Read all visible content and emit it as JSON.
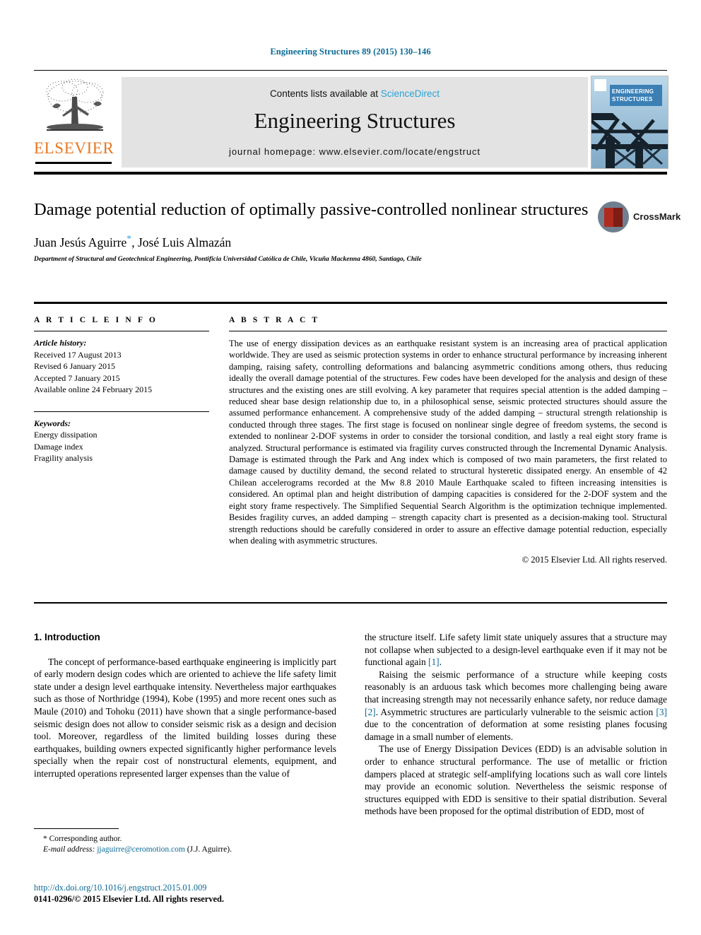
{
  "running_head": "Engineering Structures 89 (2015) 130–146",
  "masthead": {
    "contents_prefix": "Contents lists available at ",
    "sciencedirect": "ScienceDirect",
    "journal_title": "Engineering Structures",
    "homepage": "journal homepage: www.elsevier.com/locate/engstruct",
    "publisher_logo_text": "ELSEVIER",
    "cover_label": "ENGINEERING STRUCTURES",
    "sciencedirect_color": "#2aa3d6",
    "logo_color": "#e87722"
  },
  "article": {
    "title": "Damage potential reduction of optimally passive-controlled nonlinear structures",
    "authors": "Juan Jesús Aguirre",
    "authors_rest": ", José Luis Almazán",
    "corresponding_marker": "*",
    "affiliation": "Department of Structural and Geotechnical Engineering, Pontificia Universidad Católica de Chile, Vicuña Mackenna 4860, Santiago, Chile",
    "crossmark_label": "CrossMark"
  },
  "article_info": {
    "heading": "A R T I C L E  I N F O",
    "history_label": "Article history:",
    "history": [
      "Received 17 August 2013",
      "Revised 6 January 2015",
      "Accepted 7 January 2015",
      "Available online 24 February 2015"
    ],
    "keywords_label": "Keywords:",
    "keywords": [
      "Energy dissipation",
      "Damage index",
      "Fragility analysis"
    ]
  },
  "abstract": {
    "heading": "A B S T R A C T",
    "text": "The use of energy dissipation devices as an earthquake resistant system is an increasing area of practical application worldwide. They are used as seismic protection systems in order to enhance structural performance by increasing inherent damping, raising safety, controlling deformations and balancing asymmetric conditions among others, thus reducing ideally the overall damage potential of the structures. Few codes have been developed for the analysis and design of these structures and the existing ones are still evolving. A key parameter that requires special attention is the added damping – reduced shear base design relationship due to, in a philosophical sense, seismic protected structures should assure the assumed performance enhancement. A comprehensive study of the added damping – structural strength relationship is conducted through three stages. The first stage is focused on nonlinear single degree of freedom systems, the second is extended to nonlinear 2-DOF systems in order to consider the torsional condition, and lastly a real eight story frame is analyzed. Structural performance is estimated via fragility curves constructed through the Incremental Dynamic Analysis. Damage is estimated through the Park and Ang index which is composed of two main parameters, the first related to damage caused by ductility demand, the second related to structural hysteretic dissipated energy. An ensemble of 42 Chilean accelerograms recorded at the Mw 8.8 2010 Maule Earthquake scaled to fifteen increasing intensities is considered. An optimal plan and height distribution of damping capacities is considered for the 2-DOF system and the eight story frame respectively. The Simplified Sequential Search Algorithm is the optimization technique implemented. Besides fragility curves, an added damping – strength capacity chart is presented as a decision-making tool. Structural strength reductions should be carefully considered in order to assure an effective damage potential reduction, especially when dealing with asymmetric structures.",
    "copyright": "© 2015 Elsevier Ltd. All rights reserved."
  },
  "introduction": {
    "heading": "1. Introduction",
    "left_paragraph": "The concept of performance-based earthquake engineering is implicitly part of early modern design codes which are oriented to achieve the life safety limit state under a design level earthquake intensity. Nevertheless major earthquakes such as those of Northridge (1994), Kobe (1995) and more recent ones such as Maule (2010) and Tohoku (2011) have shown that a single performance-based seismic design does not allow to consider seismic risk as a design and decision tool. Moreover, regardless of the limited building losses during these earthquakes, building owners expected significantly higher performance levels specially when the repair cost of nonstructural elements, equipment, and interrupted operations represented larger expenses than the value of",
    "right_paragraph_1a": "the structure itself. Life safety limit state uniquely assures that a structure may not collapse when subjected to a design-level earthquake even if it may not be functional again ",
    "right_cite_1": "[1]",
    "right_paragraph_1b": ".",
    "right_paragraph_2a": "Raising the seismic performance of a structure while keeping costs reasonably is an arduous task which becomes more challenging being aware that increasing strength may not necessarily enhance safety, nor reduce damage ",
    "right_cite_2": "[2]",
    "right_paragraph_2b": ". Asymmetric structures are particularly vulnerable to the seismic action ",
    "right_cite_3": "[3]",
    "right_paragraph_2c": " due to the concentration of deformation at some resisting planes focusing damage in a small number of elements.",
    "right_paragraph_3": "The use of Energy Dissipation Devices (EDD) is an advisable solution in order to enhance structural performance. The use of metallic or friction dampers placed at strategic self-amplifying locations such as wall core lintels may provide an economic solution. Nevertheless the seismic response of structures equipped with EDD is sensitive to their spatial distribution. Several methods have been proposed for the optimal distribution of EDD, most of"
  },
  "footnote": {
    "corresponding": "* Corresponding author.",
    "email_label": "E-mail address:",
    "email": "jjaguirre@ceromotion.com",
    "email_owner": " (J.J. Aguirre)."
  },
  "footer": {
    "doi": "http://dx.doi.org/10.1016/j.engstruct.2015.01.009",
    "issn_line": "0141-0296/© 2015 Elsevier Ltd. All rights reserved."
  }
}
